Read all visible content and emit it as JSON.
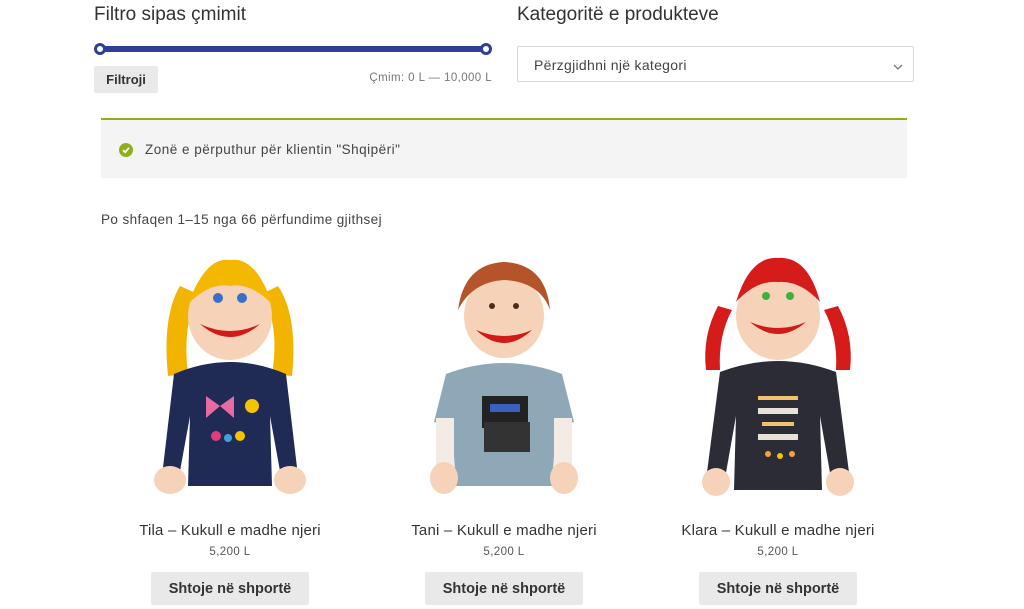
{
  "price_filter": {
    "title": "Filtro sipas çmimit",
    "button_label": "Filtroji",
    "range_text": "Çmim: 0 L — 10,000 L",
    "min_fraction": 0,
    "max_fraction": 1,
    "accent_color": "#2f3f96"
  },
  "category_filter": {
    "title": "Kategoritë e produkteve",
    "placeholder": "Përzgjidhni një kategori",
    "icon": "chevron-down-icon"
  },
  "notice": {
    "message": "Zonë e përputhur për klientin \"Shqipëri\"",
    "icon": "check-circle-icon",
    "accent_color": "#8fae1b"
  },
  "result_count": "Po shfaqen 1–15 nga 66 përfundime gjithsej",
  "products": [
    {
      "name": "Tila – Kukull e madhe njeri",
      "price": "5,200 L",
      "button": "Shtoje në shportë"
    },
    {
      "name": "Tani – Kukull e madhe njeri",
      "price": "5,200 L",
      "button": "Shtoje në shportë"
    },
    {
      "name": "Klara – Kukull e madhe njeri",
      "price": "5,200 L",
      "button": "Shtoje në shportë"
    }
  ]
}
